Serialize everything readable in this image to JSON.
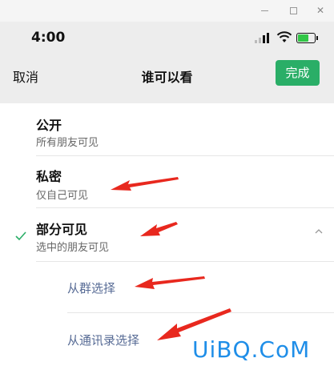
{
  "status_bar": {
    "time": "4:00"
  },
  "nav": {
    "cancel": "取消",
    "title": "谁可以看",
    "done": "完成"
  },
  "options": [
    {
      "title": "公开",
      "subtitle": "所有朋友可见",
      "selected": false
    },
    {
      "title": "私密",
      "subtitle": "仅自己可见",
      "selected": false
    },
    {
      "title": "部分可见",
      "subtitle": "选中的朋友可见",
      "selected": true,
      "expanded": true
    }
  ],
  "sub_options": [
    "从群选择",
    "从通讯录选择"
  ],
  "colors": {
    "accent": "#2aae67",
    "link": "#576b95",
    "arrow": "#e8281e",
    "watermark": "#1f8ee8"
  },
  "icons": [
    "minimize-icon",
    "maximize-icon",
    "close-icon",
    "signal-icon",
    "wifi-icon",
    "battery-icon",
    "checkmark-icon",
    "chevron-up-icon"
  ],
  "watermark": "UiBQ.CoM"
}
